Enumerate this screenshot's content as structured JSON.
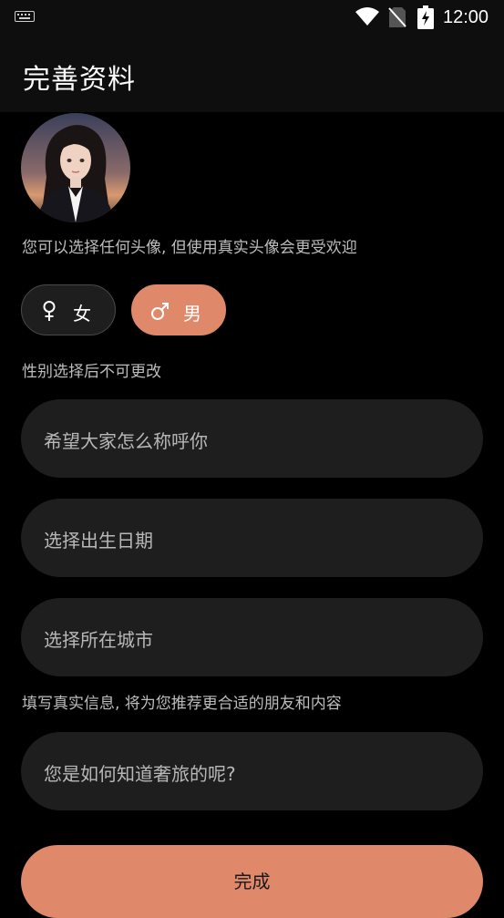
{
  "status_bar": {
    "time": "12:00",
    "icons": [
      "keyboard-icon",
      "wifi-icon",
      "no-sim-icon",
      "battery-charging-icon"
    ]
  },
  "header": {
    "title": "完善资料"
  },
  "avatar": {
    "hint": "您可以选择任何头像, 但使用真实头像会更受欢迎"
  },
  "gender": {
    "options": [
      {
        "label": "女",
        "icon": "female-icon",
        "selected": false
      },
      {
        "label": "男",
        "icon": "male-icon",
        "selected": true
      }
    ],
    "hint": "性别选择后不可更改"
  },
  "form": {
    "nickname_placeholder": "希望大家怎么称呼你",
    "birthday_placeholder": "选择出生日期",
    "city_placeholder": "选择所在城市",
    "info_hint": "填写真实信息, 将为您推荐更合适的朋友和内容",
    "source_placeholder": "您是如何知道奢旅的呢?"
  },
  "actions": {
    "finish_label": "完成"
  },
  "colors": {
    "accent": "#e0886a",
    "background": "#000000",
    "field": "#1e1e1e"
  }
}
